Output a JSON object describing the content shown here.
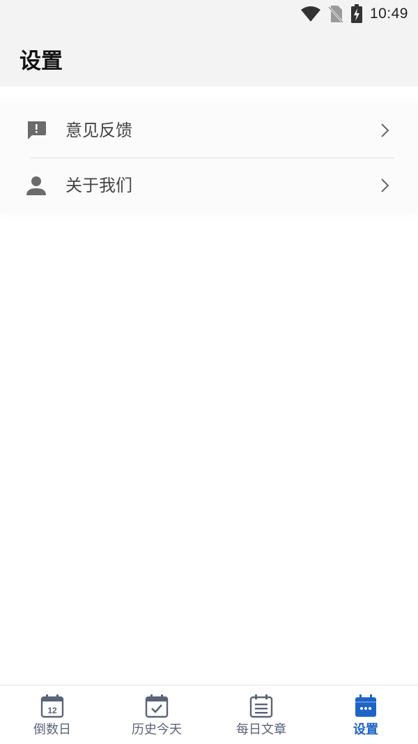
{
  "status_bar": {
    "time": "10:49",
    "icons": [
      "wifi-icon",
      "no-sim-icon",
      "battery-charging-icon"
    ]
  },
  "header": {
    "title": "设置"
  },
  "settings": {
    "items": [
      {
        "label": "意见反馈",
        "icon": "feedback-icon"
      },
      {
        "label": "关于我们",
        "icon": "person-icon"
      }
    ]
  },
  "bottom_nav": {
    "items": [
      {
        "label": "倒数日",
        "icon": "calendar-12-icon",
        "icon_text": "12",
        "active": false
      },
      {
        "label": "历史今天",
        "icon": "calendar-check-icon",
        "active": false
      },
      {
        "label": "每日文章",
        "icon": "article-list-icon",
        "active": false
      },
      {
        "label": "设置",
        "icon": "calendar-dots-icon",
        "active": true
      }
    ]
  },
  "colors": {
    "accent": "#1e64c8",
    "nav_inactive": "#5a6378",
    "icon_gray": "#6b6b6b",
    "header_bg": "#f3f3f3"
  }
}
